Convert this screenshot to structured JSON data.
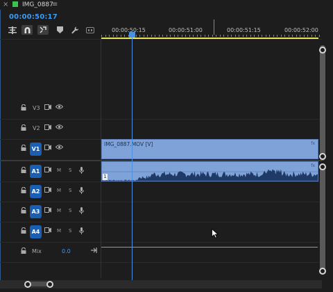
{
  "tab": {
    "close_glyph": "×",
    "title": "IMG_0887",
    "menu_glyph": "≡",
    "color": "#3ec04a"
  },
  "timecode": "00:00:50:17",
  "toolbar": {
    "icons": [
      "insert-overwrite-icon",
      "snap-magnet-icon",
      "linked-selection-icon",
      "add-marker-icon",
      "wrench-settings-icon",
      "captions-icon"
    ]
  },
  "ruler": {
    "labels": [
      "00:00:50:15",
      "00:00:51:00",
      "00:00:51:15",
      "00:00:52:00"
    ]
  },
  "tracks": {
    "video": [
      {
        "name": "V3",
        "active": false
      },
      {
        "name": "V2",
        "active": false
      },
      {
        "name": "V1",
        "active": true
      }
    ],
    "audio": [
      {
        "name": "A1",
        "m": "M",
        "s": "S"
      },
      {
        "name": "A2",
        "m": "M",
        "s": "S"
      },
      {
        "name": "A3",
        "m": "M",
        "s": "S"
      },
      {
        "name": "A4",
        "m": "M",
        "s": "S"
      }
    ],
    "mix": {
      "label": "Mix",
      "value": "0.0"
    }
  },
  "clips": {
    "video": {
      "label": "IMG_0887.MOV [V]",
      "fx": "fx"
    },
    "audio": {
      "number": "1",
      "fx": "fx"
    }
  },
  "colors": {
    "accent": "#3d9bf5",
    "clip": "#7fa3d8",
    "track_active": "#1a5fb4",
    "work_area": "#e6e25a"
  }
}
